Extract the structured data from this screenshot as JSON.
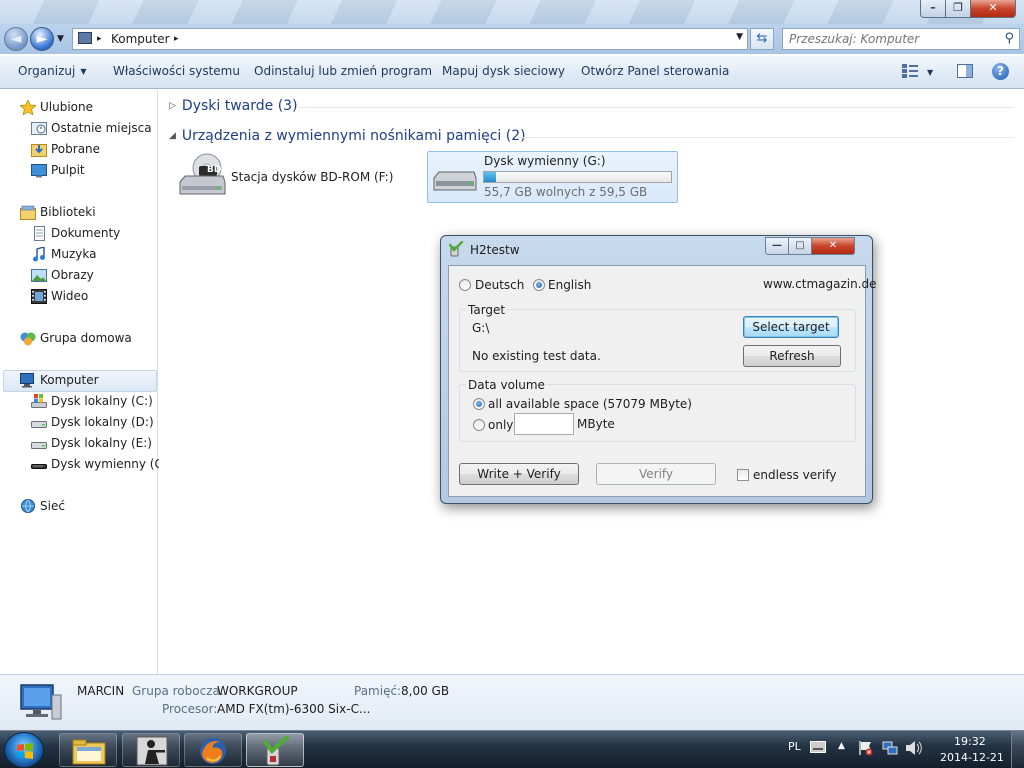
{
  "window": {
    "controls": {
      "minimize": "–",
      "maximize": "❐",
      "close": "✕"
    }
  },
  "nav": {
    "back_icon": "back-arrow-icon",
    "forward_icon": "forward-arrow-icon",
    "breadcrumb": [
      "Komputer"
    ],
    "crumb_sep": "▸",
    "search_placeholder": "Przeszukaj: Komputer"
  },
  "toolbar": {
    "organize": "Organizuj",
    "system_properties": "Właściwości systemu",
    "uninstall": "Odinstaluj lub zmień program",
    "map_drive": "Mapuj dysk sieciowy",
    "control_panel": "Otwórz Panel sterowania",
    "help": "?"
  },
  "sidebar": {
    "items": [
      {
        "label": "Ulubione",
        "icon": "star-icon"
      },
      {
        "label": "Ostatnie miejsca",
        "icon": "recent-places-icon"
      },
      {
        "label": "Pobrane",
        "icon": "downloads-folder-icon"
      },
      {
        "label": "Pulpit",
        "icon": "desktop-icon"
      },
      {
        "label": "Biblioteki",
        "icon": "libraries-icon"
      },
      {
        "label": "Dokumenty",
        "icon": "documents-icon"
      },
      {
        "label": "Muzyka",
        "icon": "music-icon"
      },
      {
        "label": "Obrazy",
        "icon": "pictures-icon"
      },
      {
        "label": "Wideo",
        "icon": "video-icon"
      },
      {
        "label": "Grupa domowa",
        "icon": "homegroup-icon"
      },
      {
        "label": "Komputer",
        "icon": "computer-icon"
      },
      {
        "label": "Dysk lokalny (C:)",
        "icon": "system-drive-icon"
      },
      {
        "label": "Dysk lokalny (D:)",
        "icon": "drive-icon"
      },
      {
        "label": "Dysk lokalny (E:)",
        "icon": "drive-icon"
      },
      {
        "label": "Dysk wymienny (G:)",
        "icon": "removable-drive-icon"
      },
      {
        "label": "Sieć",
        "icon": "network-icon"
      }
    ]
  },
  "content": {
    "group_hard_disks": "Dyski twarde (3)",
    "group_removable": "Urządzenia z wymiennymi nośnikami pamięci (2)",
    "bd_drive": {
      "name": "Stacja dysków BD-ROM (F:)",
      "badge": "BD"
    },
    "usb_drive": {
      "name": "Dysk wymienny (G:)",
      "free_text": "55,7 GB wolnych z 59,5 GB",
      "used_fraction": 0.064
    }
  },
  "details": {
    "computer_name": "MARCIN",
    "workgroup_label": "Grupa robocza:",
    "workgroup_value": "WORKGROUP",
    "memory_label": "Pamięć:",
    "memory_value": "8,00 GB",
    "cpu_label": "Procesor:",
    "cpu_value": "AMD FX(tm)-6300 Six-C..."
  },
  "dialog": {
    "title": "H2testw",
    "lang_de": "Deutsch",
    "lang_en": "English",
    "selected_lang": "English",
    "website": "www.ctmagazin.de",
    "target_legend": "Target",
    "target_path": "G:\\",
    "target_status": "No existing test data.",
    "select_target": "Select target",
    "refresh": "Refresh",
    "volume_legend": "Data volume",
    "all_space": "all available space (57079 MByte)",
    "only": "only",
    "only_value": "",
    "mbyte": "MByte",
    "write_verify": "Write + Verify",
    "verify": "Verify",
    "endless_verify": "endless verify",
    "endless_checked": false
  },
  "taskbar": {
    "apps": [
      "explorer-icon",
      "counter-strike-icon",
      "firefox-icon",
      "h2testw-icon"
    ],
    "active_app": "h2testw-icon",
    "lang": "PL",
    "time": "19:32",
    "date": "2014-12-21"
  }
}
